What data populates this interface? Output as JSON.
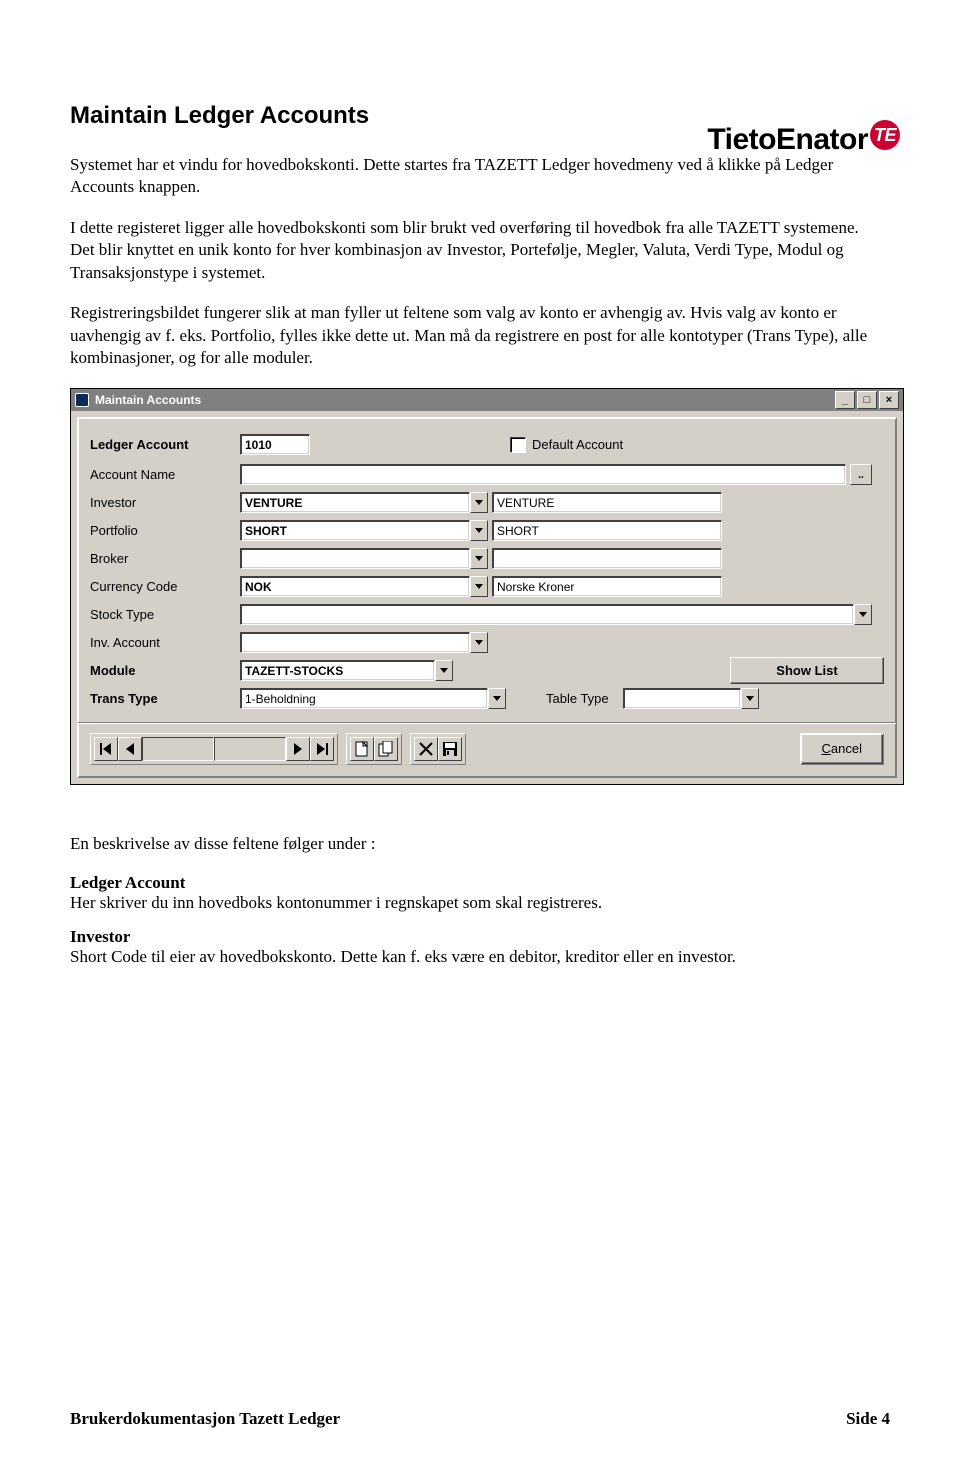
{
  "logo": {
    "main": "TietoEnator",
    "badge": "TE"
  },
  "page": {
    "heading": "Maintain Ledger Accounts",
    "para1": "Systemet har et vindu for hovedbokskonti. Dette startes fra TAZETT Ledger hovedmeny ved å klikke på Ledger Accounts knappen.",
    "para2": "I dette registeret ligger alle hovedbokskonti som blir brukt ved overføring til hovedbok fra alle TAZETT systemene.",
    "para3": "Det blir knyttet en unik konto for hver kombinasjon av Investor, Portefølje, Megler, Valuta, Verdi Type, Modul og Transaksjonstype i systemet.",
    "para4": "Registreringsbildet fungerer slik at man fyller ut feltene som valg av konto er avhengig av. Hvis valg av konto er uavhengig av f. eks. Portfolio, fylles ikke dette ut. Man må da registrere en post for alle kontotyper (Trans Type), alle kombinasjoner, og for alle moduler.",
    "after_window_intro": "En beskrivelse av disse feltene følger under :",
    "field1_label": "Ledger Account",
    "field1_text": "Her skriver du inn hovedboks kontonummer i regnskapet som skal registreres.",
    "field2_label": "Investor",
    "field2_text": "Short Code til eier av hovedbokskonto. Dette kan f. eks være en debitor, kreditor eller en investor."
  },
  "window": {
    "title": "Maintain Accounts",
    "labels": {
      "ledger_account": "Ledger Account",
      "account_name": "Account Name",
      "investor": "Investor",
      "portfolio": "Portfolio",
      "broker": "Broker",
      "currency_code": "Currency Code",
      "stock_type": "Stock Type",
      "inv_account": "Inv. Account",
      "module": "Module",
      "trans_type": "Trans Type",
      "default_account": "Default Account",
      "table_type": "Table Type",
      "show_list": "Show List",
      "cancel": "ancel",
      "cancel_prefix": "C",
      "ellipsis": ".."
    },
    "values": {
      "ledger_account": "1010",
      "account_name": "",
      "investor": "VENTURE",
      "investor_desc": "VENTURE",
      "portfolio": "SHORT",
      "portfolio_desc": "SHORT",
      "broker": "",
      "broker_desc": "",
      "currency_code": "NOK",
      "currency_desc": "Norske Kroner",
      "stock_type": "",
      "inv_account": "",
      "module": "TAZETT-STOCKS",
      "trans_type": "1-Beholdning",
      "table_type": ""
    },
    "win_buttons": {
      "min": "_",
      "max": "□",
      "close": "×"
    }
  },
  "footer": {
    "left": "Brukerdokumentasjon Tazett Ledger",
    "right": "Side 4"
  }
}
